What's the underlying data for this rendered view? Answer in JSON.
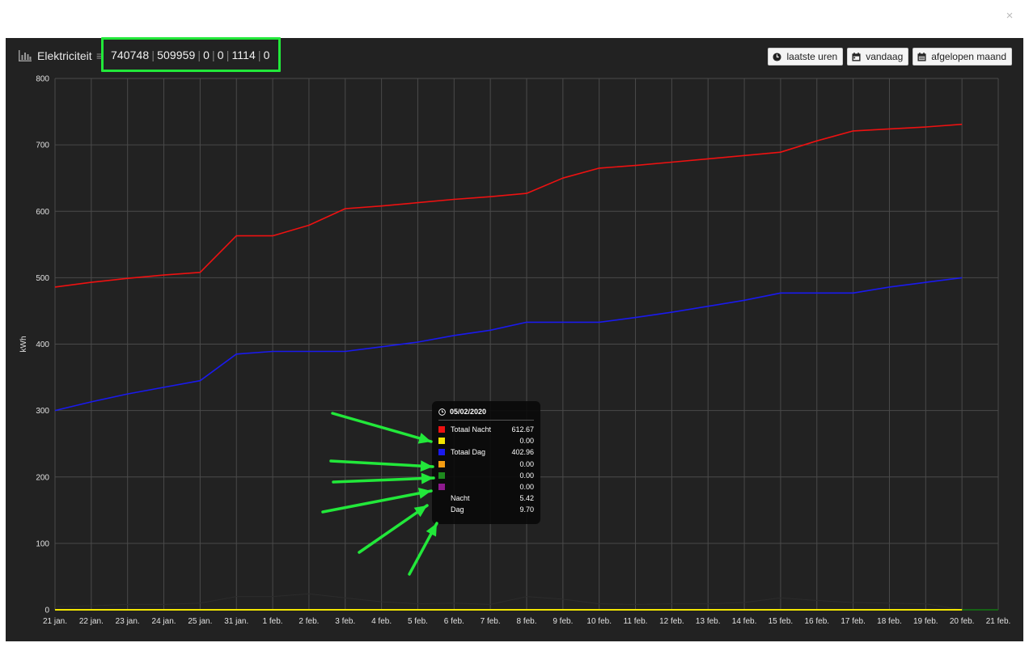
{
  "modal": {
    "close_label": "×"
  },
  "header": {
    "title": "Elektriciteit",
    "equiv": "≡",
    "stats": [
      "740748",
      "509959",
      "0",
      "0",
      "1114",
      "0"
    ],
    "buttons": [
      {
        "label": "laatste uren",
        "icon": "clock-icon"
      },
      {
        "label": "vandaag",
        "icon": "calendar-icon"
      },
      {
        "label": "afgelopen maand",
        "icon": "calendar-icon"
      }
    ]
  },
  "chart_data": {
    "type": "line",
    "ylabel": "kWh",
    "ylim": [
      0,
      800
    ],
    "yticks": [
      0,
      100,
      200,
      300,
      400,
      500,
      600,
      700,
      800
    ],
    "categories": [
      "21 jan.",
      "22 jan.",
      "23 jan.",
      "24 jan.",
      "25 jan.",
      "31 jan.",
      "1 feb.",
      "2 feb.",
      "3 feb.",
      "4 feb.",
      "5 feb.",
      "6 feb.",
      "7 feb.",
      "8 feb.",
      "9 feb.",
      "10 feb.",
      "11 feb.",
      "12 feb.",
      "13 feb.",
      "14 feb.",
      "15 feb.",
      "16 feb.",
      "17 feb.",
      "18 feb.",
      "19 feb.",
      "20 feb.",
      "21 feb."
    ],
    "grid": true,
    "series": [
      {
        "name": "Totaal Nacht",
        "color": "#ee1111",
        "values": [
          486,
          493,
          499,
          504,
          508,
          563,
          563,
          579,
          604,
          608,
          613,
          618,
          622,
          627,
          650,
          665,
          669,
          674,
          679,
          684,
          689,
          706,
          721,
          724,
          727,
          731,
          null
        ]
      },
      {
        "name": "Totaal Dag",
        "color": "#1a1aee",
        "values": [
          300,
          313,
          325,
          335,
          345,
          385,
          389,
          389,
          389,
          396,
          403,
          413,
          421,
          433,
          433,
          433,
          440,
          448,
          457,
          466,
          477,
          477,
          477,
          486,
          493,
          500,
          null
        ]
      },
      {
        "name": "",
        "color": "#f2e600",
        "values": [
          0,
          0,
          0,
          0,
          0,
          0,
          0,
          0,
          0,
          0,
          0,
          0,
          0,
          0,
          0,
          0,
          0,
          0,
          0,
          0,
          0,
          0,
          0,
          0,
          0,
          0,
          null
        ]
      },
      {
        "name": "",
        "color": "#117711",
        "values": [
          null,
          null,
          null,
          null,
          null,
          null,
          null,
          null,
          null,
          null,
          null,
          null,
          null,
          null,
          null,
          null,
          null,
          null,
          null,
          null,
          null,
          null,
          null,
          null,
          null,
          0,
          0
        ]
      },
      {
        "name": "Dag",
        "color": "#2c2c2c",
        "values": [
          5,
          6,
          8,
          8,
          10,
          20,
          20,
          24,
          18,
          12,
          9,
          10,
          8,
          20,
          16,
          9,
          8,
          9,
          9,
          11,
          18,
          14,
          11,
          10,
          9,
          0,
          null
        ]
      }
    ]
  },
  "tooltip": {
    "date": "05/02/2020",
    "rows": [
      {
        "color": "#ee1111",
        "label": "Totaal Nacht",
        "value": "612.67"
      },
      {
        "color": "#f2e600",
        "label": "",
        "value": "0.00"
      },
      {
        "color": "#1a1aee",
        "label": "Totaal Dag",
        "value": "402.96"
      },
      {
        "color": "#f39c12",
        "label": "",
        "value": "0.00"
      },
      {
        "color": "#1e8a1e",
        "label": "",
        "value": "0.00"
      },
      {
        "color": "#8e1a8e",
        "label": "",
        "value": "0.00"
      },
      {
        "color": "",
        "label": "Nacht",
        "value": "5.42"
      },
      {
        "color": "",
        "label": "Dag",
        "value": "9.70"
      }
    ]
  },
  "annotation": {
    "box_color": "#22e83a",
    "arrow_color": "#22e83a"
  }
}
